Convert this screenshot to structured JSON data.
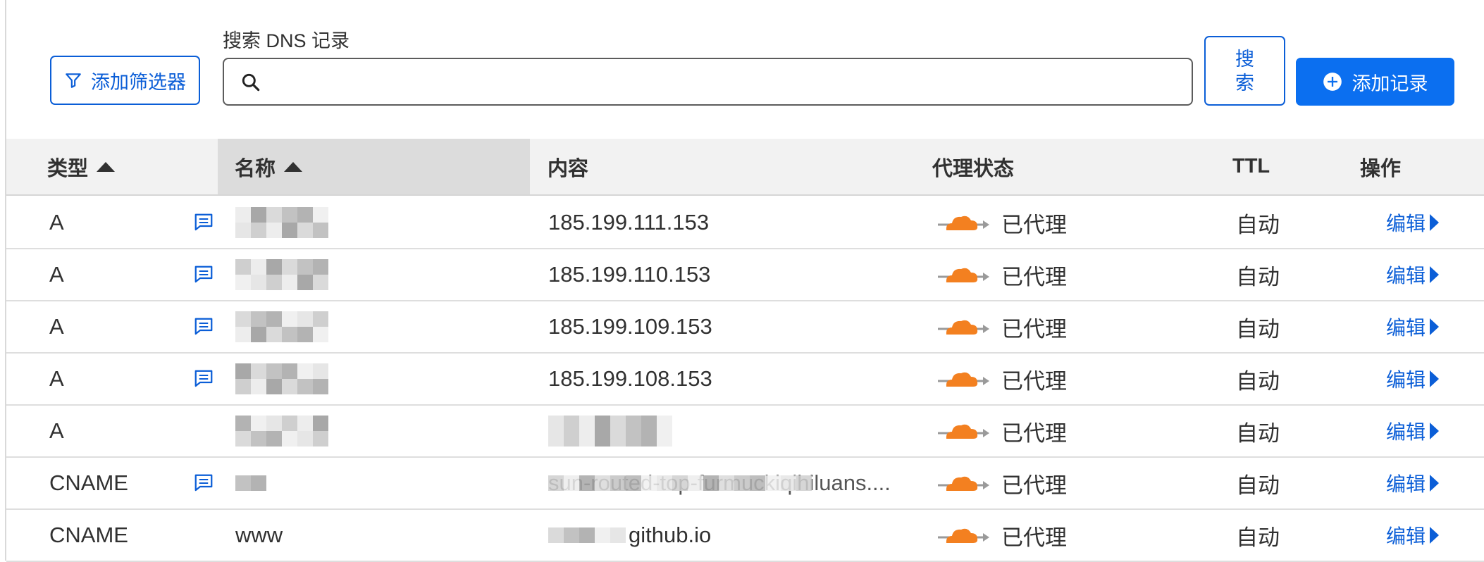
{
  "toolbar": {
    "filter_button": "添加筛选器",
    "search_label": "搜索 DNS 记录",
    "search_value": "",
    "search_placeholder": "",
    "search_button": "搜索",
    "add_button": "添加记录"
  },
  "table": {
    "columns": {
      "type": "类型",
      "name": "名称",
      "content": "内容",
      "proxy": "代理状态",
      "ttl": "TTL",
      "actions": "操作"
    },
    "rows": [
      {
        "type": "A",
        "has_comment": true,
        "name": "",
        "content": "185.199.111.153",
        "proxy": "已代理",
        "ttl": "自动",
        "action": "编辑"
      },
      {
        "type": "A",
        "has_comment": true,
        "name": "",
        "content": "185.199.110.153",
        "proxy": "已代理",
        "ttl": "自动",
        "action": "编辑"
      },
      {
        "type": "A",
        "has_comment": true,
        "name": "",
        "content": "185.199.109.153",
        "proxy": "已代理",
        "ttl": "自动",
        "action": "编辑"
      },
      {
        "type": "A",
        "has_comment": true,
        "name": "",
        "content": "185.199.108.153",
        "proxy": "已代理",
        "ttl": "自动",
        "action": "编辑"
      },
      {
        "type": "A",
        "has_comment": false,
        "name": "",
        "content": "",
        "proxy": "已代理",
        "ttl": "自动",
        "action": "编辑"
      },
      {
        "type": "CNAME",
        "has_comment": true,
        "name": "",
        "content": "sun-routed-top-furmuckiqihiluans....",
        "proxy": "已代理",
        "ttl": "自动",
        "action": "编辑"
      },
      {
        "type": "CNAME",
        "has_comment": false,
        "name": "www",
        "content": "github.io",
        "proxy": "已代理",
        "ttl": "自动",
        "action": "编辑"
      }
    ]
  },
  "icons": {
    "filter": "filter-icon",
    "search": "search-icon",
    "add": "plus-circle-icon",
    "comment": "comment-icon",
    "proxy": "cloudflare-proxied-cloud-icon",
    "sort": "sort-ascending-icon",
    "edit": "caret-right-icon"
  },
  "colors": {
    "accent": "#0b6ff0",
    "link": "#0b5ed7",
    "cloud": "#f38020",
    "header_bg": "#f2f2f2"
  }
}
